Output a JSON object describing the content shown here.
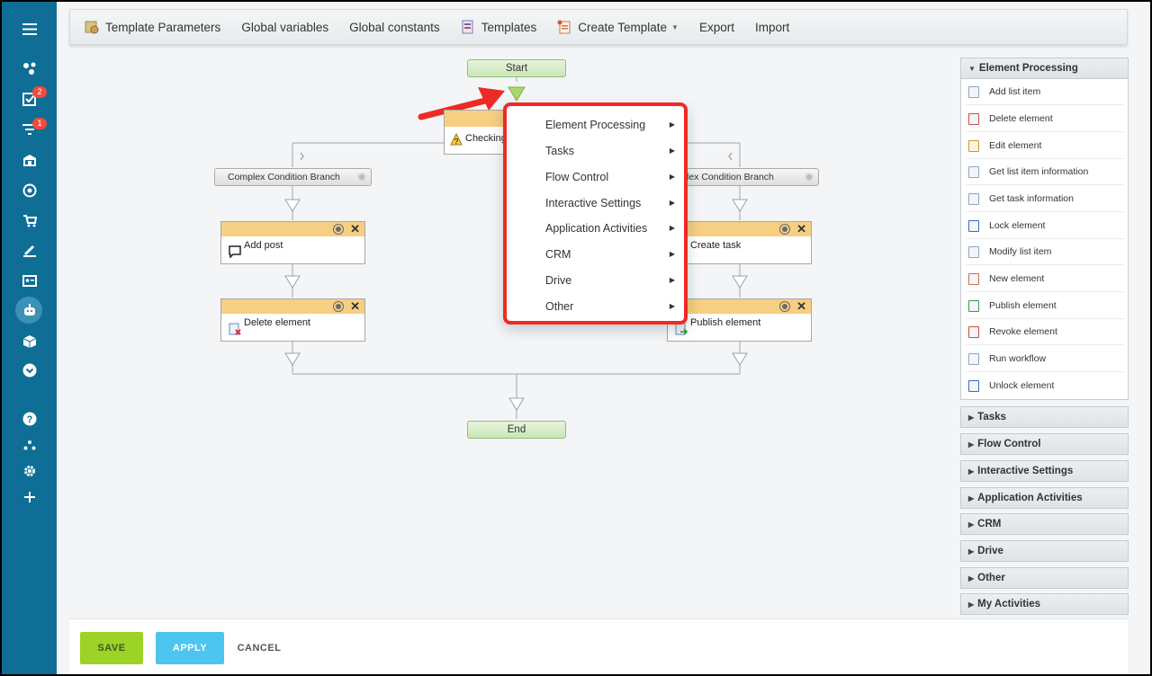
{
  "toolbar": {
    "items": [
      {
        "label": "Template Parameters",
        "icon": "template-params-icon"
      },
      {
        "label": "Global variables"
      },
      {
        "label": "Global constants"
      },
      {
        "label": "Templates",
        "icon": "templates-icon"
      },
      {
        "label": "Create Template",
        "icon": "create-template-icon",
        "dropdown": true
      },
      {
        "label": "Export"
      },
      {
        "label": "Import"
      }
    ]
  },
  "sidebar": {
    "badges": {
      "tasks": "2",
      "feed": "1"
    }
  },
  "workflow": {
    "start": "Start",
    "end": "End",
    "condition": "Checking",
    "branch_left": "Complex Condition Branch",
    "branch_right": "Complex Condition Branch",
    "left_acts": [
      "Add post",
      "Delete element"
    ],
    "right_acts": [
      "Create task",
      "Publish element"
    ]
  },
  "context_menu": {
    "items": [
      "Element Processing",
      "Tasks",
      "Flow Control",
      "Interactive Settings",
      "Application Activities",
      "CRM",
      "Drive",
      "Other"
    ]
  },
  "right_panel": {
    "open_section": "Element Processing",
    "items": [
      "Add list item",
      "Delete element",
      "Edit element",
      "Get list item information",
      "Get task information",
      "Lock element",
      "Modify list item",
      "New element",
      "Publish element",
      "Revoke element",
      "Run workflow",
      "Unlock element"
    ],
    "sections": [
      "Tasks",
      "Flow Control",
      "Interactive Settings",
      "Application Activities",
      "CRM",
      "Drive",
      "Other",
      "My Activities"
    ]
  },
  "footer": {
    "save": "SAVE",
    "apply": "APPLY",
    "cancel": "CANCEL"
  },
  "colors": {
    "sidebar": "#0e6e95",
    "highlight": "#ee2a24",
    "save": "#9dd226",
    "apply": "#4cc5ef",
    "activity_header": "#f6cf82"
  }
}
